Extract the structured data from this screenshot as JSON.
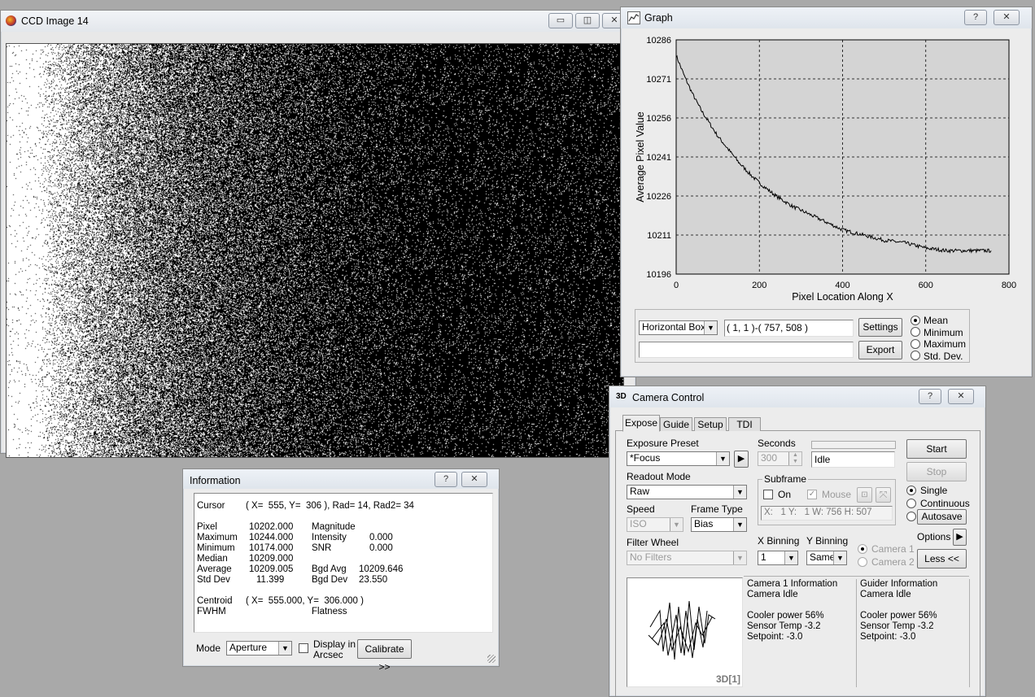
{
  "ccd_window": {
    "title": "CCD Image 14"
  },
  "graph_window": {
    "title": "Graph",
    "help_btn": "?",
    "close_btn": "✕",
    "chart_data": {
      "type": "line",
      "xlabel": "Pixel Location Along X",
      "ylabel": "Average Pixel Value",
      "xlim": [
        0,
        800
      ],
      "ylim": [
        10196,
        10286
      ],
      "xticks": [
        "0",
        "200",
        "400",
        "600",
        "800"
      ],
      "yticks": [
        "10286",
        "10271",
        "10256",
        "10241",
        "10226",
        "10211",
        "10196"
      ],
      "grid": true,
      "series": [
        {
          "x": [
            0,
            20,
            40,
            60,
            80,
            100,
            120,
            150,
            180,
            200,
            240,
            280,
            320,
            360,
            400,
            450,
            500,
            550,
            600,
            650,
            700,
            757
          ],
          "y": [
            10280,
            10272,
            10265,
            10259,
            10254,
            10249,
            10245,
            10239,
            10234,
            10231,
            10226,
            10222,
            10219,
            10216,
            10213,
            10211,
            10209,
            10208,
            10206,
            10205,
            10205,
            10205
          ]
        }
      ]
    },
    "mode_combo": "Horizontal Box",
    "range_text": "( 1, 1 )-( 757, 508 )",
    "settings_btn": "Settings",
    "export_btn": "Export",
    "radio": {
      "mean": "Mean",
      "minimum": "Minimum",
      "maximum": "Maximum",
      "stddev": "Std. Dev."
    }
  },
  "info_window": {
    "title": "Information",
    "cursor_label": "Cursor",
    "cursor_value": "( X=  555, Y=  306 ), Rad= 14, Rad2= 34",
    "stats_labels": [
      "Pixel",
      "Maximum",
      "Minimum",
      "Median",
      "Average",
      "Std Dev"
    ],
    "stats_values": [
      "10202.000",
      "10244.000",
      "10174.000",
      "10209.000",
      "10209.005",
      "11.399"
    ],
    "right_labels": [
      "Magnitude",
      "Intensity",
      "SNR",
      "",
      "Bgd Avg",
      "Bgd Dev"
    ],
    "right_values": [
      "",
      "0.000",
      "0.000",
      "",
      "10209.646",
      "23.550"
    ],
    "centroid_label": "Centroid",
    "centroid_value": "( X=  555.000, Y=  306.000 )",
    "fwhm_label": "FWHM",
    "flatness_label": "Flatness",
    "mode_label": "Mode",
    "mode_value": "Aperture",
    "display_label_1": "Display in",
    "display_label_2": "Arcsec",
    "calibrate_btn": "Calibrate >>"
  },
  "camera_window": {
    "title": "Camera Control",
    "tabs": [
      "Expose",
      "Guide",
      "Setup",
      "TDI"
    ],
    "exposure_preset_label": "Exposure Preset",
    "exposure_preset_value": "*Focus",
    "seconds_label": "Seconds",
    "seconds_value": "300",
    "status_value": "Idle",
    "start_btn": "Start",
    "stop_btn": "Stop",
    "readout_label": "Readout Mode",
    "readout_value": "Raw",
    "subframe_label": "Subframe",
    "on_label": "On",
    "mouse_label": "Mouse",
    "subframe_coords": "X:   1 Y:   1 W: 756 H: 507",
    "speed_label": "Speed",
    "speed_value": "ISO",
    "frame_type_label": "Frame Type",
    "frame_type_value": "Bias",
    "single_label": "Single",
    "continuous_label": "Continuous",
    "autosave_label": "Autosave",
    "options_label": "Options",
    "filter_label": "Filter Wheel",
    "filter_value": "No Filters",
    "xbin_label": "X Binning",
    "xbin_value": "1",
    "ybin_label": "Y Binning",
    "ybin_value": "Same",
    "camera1_label": "Camera 1",
    "camera2_label": "Camera 2",
    "less_btn": "Less <<",
    "preview_label": "3D[1]",
    "cam1_info": [
      "Camera 1 Information",
      "Camera Idle",
      "",
      "Cooler power 56%",
      "Sensor Temp -3.2",
      "Setpoint: -3.0"
    ],
    "guider_info": [
      "Guider Information",
      "Camera Idle",
      "",
      "Cooler power 56%",
      "Sensor Temp -3.2",
      "Setpoint: -3.0"
    ]
  }
}
